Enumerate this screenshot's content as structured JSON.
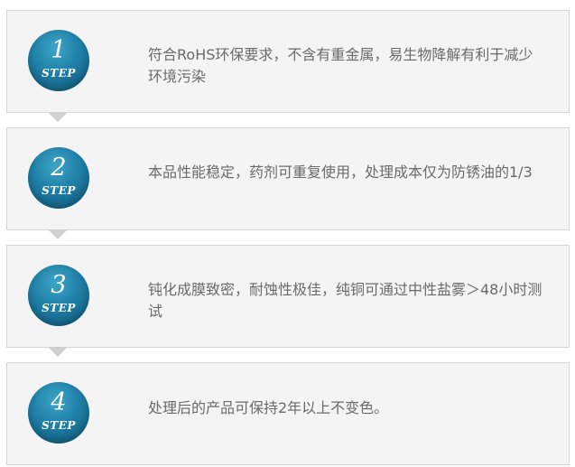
{
  "steps": [
    {
      "number": "1",
      "step_label": "STEP",
      "description": "符合RoHS环保要求，不含有重金属，易生物降解有利于减少环境污染"
    },
    {
      "number": "2",
      "step_label": "STEP",
      "description": "本品性能稳定，药剂可重复使用，处理成本仅为防锈油的1/3"
    },
    {
      "number": "3",
      "step_label": "STEP",
      "description": "钝化成膜致密，耐蚀性极佳，纯铜可通过中性盐雾＞48小时测试"
    },
    {
      "number": "4",
      "step_label": "STEP",
      "description": "处理后的产品可保持2年以上不变色。"
    }
  ],
  "colors": {
    "badge_gradient_light": "#3ea6c9",
    "badge_gradient_dark": "#0f5677",
    "card_background": "#f4f4f4",
    "text": "#6a6a6a"
  }
}
